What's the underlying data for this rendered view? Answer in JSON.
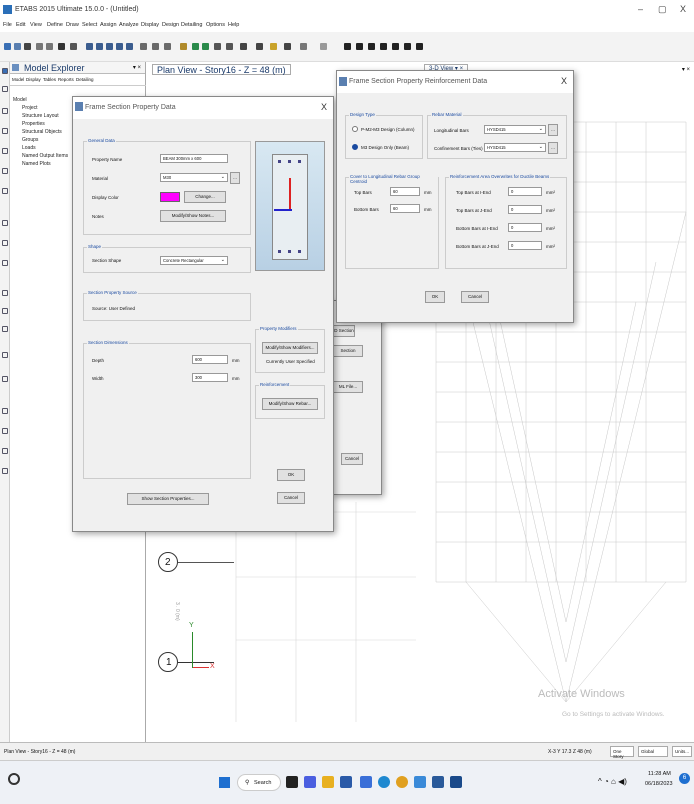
{
  "app": {
    "title": "ETABS 2015 Ultimate 15.0.0 - (Untitled)",
    "minimize": "–",
    "maximize": "▢",
    "close": "X"
  },
  "menu": [
    "File",
    "Edit",
    "View",
    "Define",
    "Draw",
    "Select",
    "Assign",
    "Analyze",
    "Display",
    "Design",
    "Detailing",
    "Options",
    "Help"
  ],
  "explorer": {
    "title": "Model Explorer",
    "pin": "▾ ×",
    "tabs": [
      "Model",
      "Display",
      "Tables",
      "Reports",
      "Detailing"
    ],
    "items": [
      "Model",
      "Project",
      "Structure Layout",
      "Properties",
      "Structural Objects",
      "Groups",
      "Loads",
      "Named Output Items",
      "Named Plots"
    ]
  },
  "plan": {
    "tab": "Plan View - Story16 - Z = 48 (m)",
    "tab2": "3-D View",
    "tab2_ctl": "▾ ×",
    "right_ctl": "▾ ×",
    "axis_y": "Y",
    "axis_x": "X",
    "grid1": "1",
    "grid2": "2",
    "dim": "3 . 0 (m)"
  },
  "fsp": {
    "title": "Frame Section Property Data",
    "close": "X",
    "general": "General Data",
    "prop_name_label": "Property Name",
    "prop_name": "BEAM 300mm x 600",
    "material_label": "Material",
    "material": "M30",
    "color_label": "Display Color",
    "change": "Change...",
    "notes_label": "Notes",
    "notes_btn": "Modify/Show Notes...",
    "shape": "Shape",
    "section_shape_label": "Section Shape",
    "section_shape": "Concrete Rectangular",
    "source": "Section Property Source",
    "source_text": "Source:  User Defined",
    "dims": "Section Dimensions",
    "depth_label": "Depth",
    "depth": "600",
    "width_label": "Width",
    "width": "300",
    "unit": "mm",
    "modifiers": "Property Modifiers",
    "mod_btn": "Modify/Show Modifiers...",
    "mod_status": "Currently User Specified",
    "reinforcement": "Reinforcement",
    "rebar_btn": "Modify/Show Rebar...",
    "show_props": "Show Section Properties...",
    "ok": "OK",
    "cancel": "Cancel",
    "color": "#ff00ff"
  },
  "behind": {
    "b1": "D Section",
    "b2": "Section",
    "b3": "ML File...",
    "b4": "Cancel"
  },
  "rebar": {
    "title": "Frame Section Property Reinforcement Data",
    "close": "X",
    "design_type": "Design Type",
    "p_m2_m3": "P-M2-M3 Design (Column)",
    "m3_only": "M3 Design Only (Beam)",
    "rebar_material": "Rebar Material",
    "long_label": "Longitudinal Bars",
    "long_val": "HYSD415",
    "conf_label": "Confinement Bars (Ties)",
    "conf_val": "HYSD415",
    "cover": "Cover to Longitudinal Rebar Group Centroid",
    "top_label": "Top Bars",
    "top_val": "60",
    "bot_label": "Bottom Bars",
    "bot_val": "60",
    "unit": "mm",
    "overwrites": "Reinforcement Area Overwrites for Ductile Beams",
    "ti_label": "Top Bars at I-End",
    "tj_label": "Top Bars at J-End",
    "bi_label": "Bottom Bars at I-End",
    "bj_label": "Bottom Bars at J-End",
    "ti": "0",
    "tj": "0",
    "bi": "0",
    "bj": "0",
    "area_unit": "mm²",
    "ok": "OK",
    "cancel": "Cancel"
  },
  "watermark": {
    "l1": "Activate Windows",
    "l2": "Go to Settings to activate Windows."
  },
  "status": {
    "left": "Plan View - Story16 - Z = 48 (m)",
    "coords": "X-3 Y 17.3 Z 48 (m)",
    "story": "One Story",
    "global": "Global",
    "units": "Units..."
  },
  "taskbar": {
    "search": "Search",
    "time": "11:28 AM",
    "date": "06/18/2023",
    "badge": "6"
  }
}
